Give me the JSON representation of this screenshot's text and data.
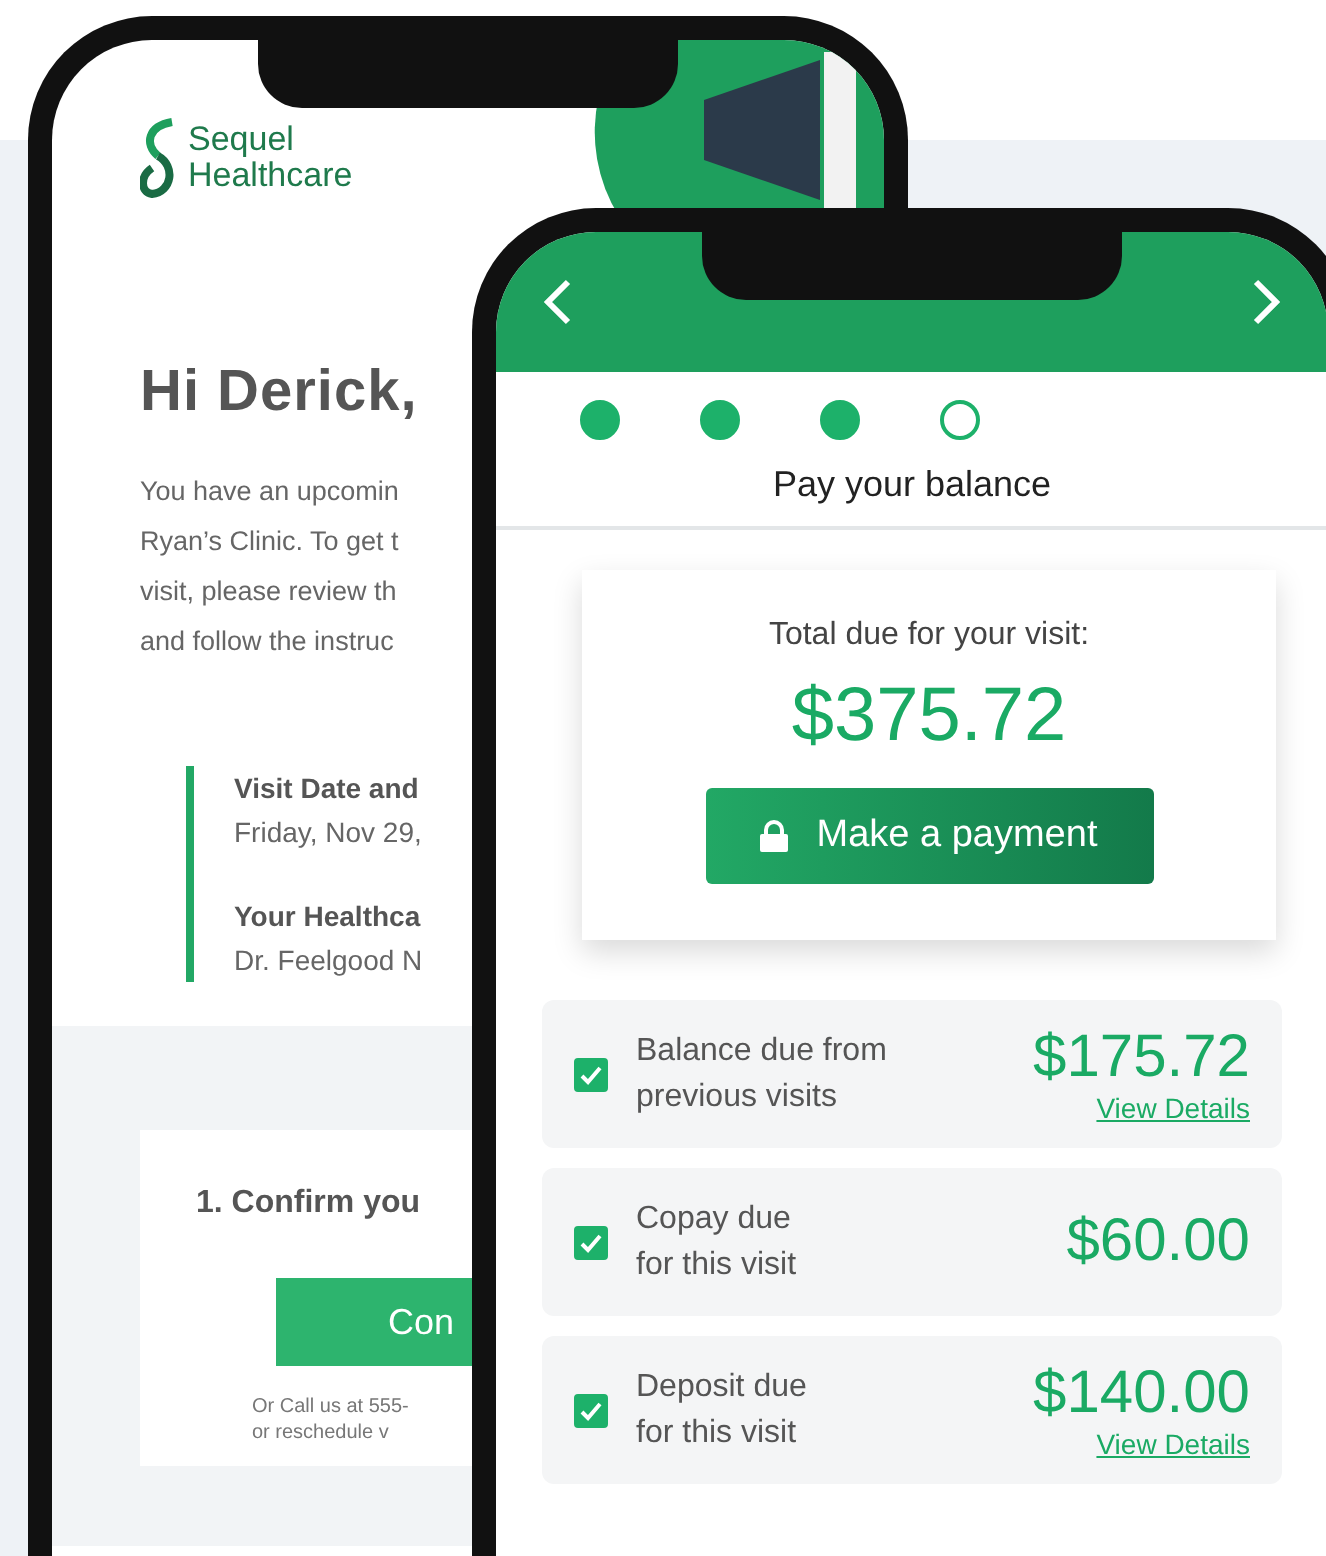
{
  "back_screen": {
    "logo": {
      "line_1": "Sequel",
      "line_2": "Healthcare"
    },
    "greeting": "Hi Derick,",
    "message_lines": [
      "You have an upcomin",
      "Ryan’s Clinic. To get t",
      "visit, please review th",
      "and follow the instruc"
    ],
    "details": [
      {
        "label": "Visit Date and",
        "value": "Friday, Nov 29,"
      },
      {
        "label": "Your Healthca",
        "value": "Dr. Feelgood N"
      }
    ],
    "step_title": "1. Confirm you",
    "button": "Con",
    "footnote_lines": [
      "Or Call us at 555-",
      "or reschedule v"
    ]
  },
  "front_screen": {
    "steps": [
      {
        "completed": true
      },
      {
        "completed": true
      },
      {
        "completed": true
      },
      {
        "completed": false
      }
    ],
    "title": "Pay your balance",
    "total": {
      "label": "Total due for your visit:",
      "amount": "$375.72",
      "button": "Make a payment"
    },
    "items": [
      {
        "label_lines": [
          "Balance due from",
          "previous visits"
        ],
        "amount": "$175.72",
        "link": "View Details",
        "checked": true
      },
      {
        "label_lines": [
          "Copay due",
          "for this visit"
        ],
        "amount": "$60.00",
        "checked": true
      },
      {
        "label_lines": [
          "Deposit due",
          "for this visit"
        ],
        "amount": "$140.00",
        "link": "View Details",
        "checked": true
      }
    ]
  }
}
